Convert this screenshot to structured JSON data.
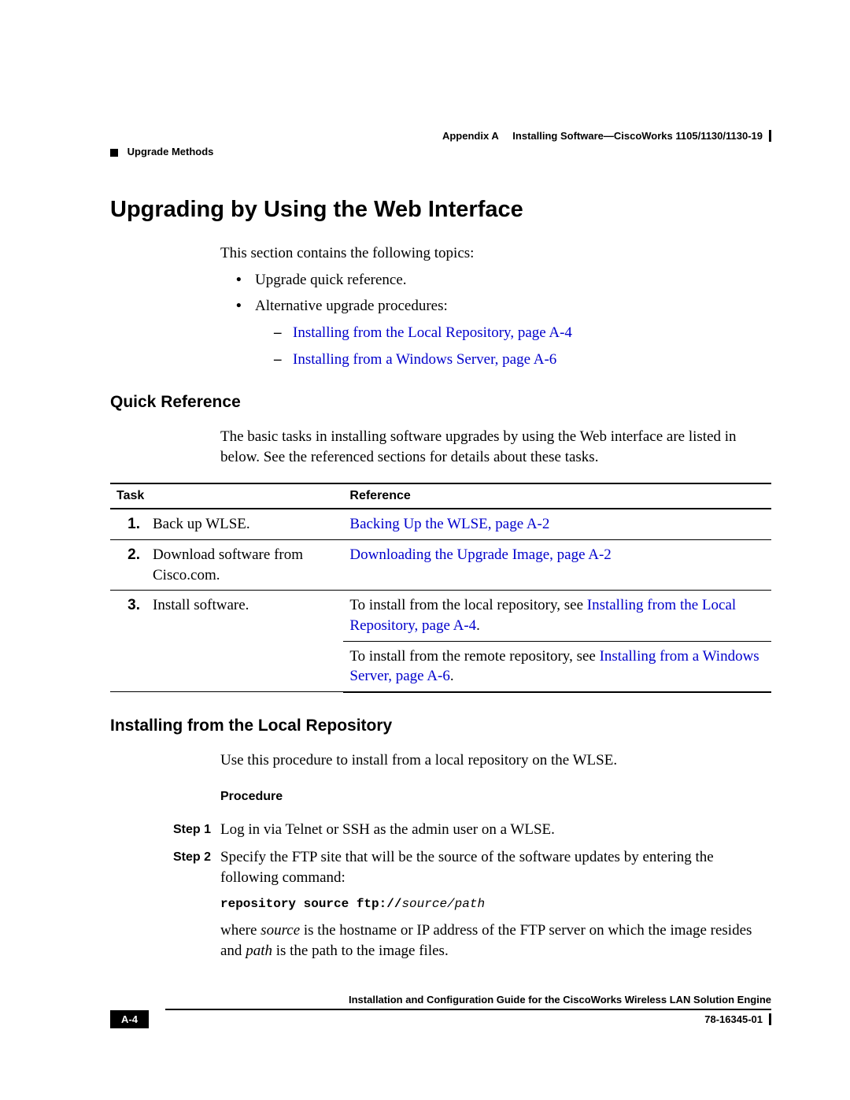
{
  "header": {
    "appendix": "Appendix A",
    "title": "Installing Software—CiscoWorks 1105/1130/1130-19",
    "section": "Upgrade Methods"
  },
  "h1": "Upgrading by Using the Web Interface",
  "intro": "This section contains the following topics:",
  "topics": {
    "item1": "Upgrade quick reference.",
    "item2": "Alternative upgrade procedures:",
    "sub1": "Installing from the Local Repository, page A-4",
    "sub2": "Installing from a Windows Server, page A-6"
  },
  "quickref": {
    "heading": "Quick Reference",
    "text": "The basic tasks in installing software upgrades by using the Web interface are listed in below. See the referenced sections for details about these tasks.",
    "th_task": "Task",
    "th_ref": "Reference",
    "rows": {
      "r1": {
        "n": "1.",
        "task": "Back up WLSE.",
        "ref": "Backing Up the WLSE, page A-2"
      },
      "r2": {
        "n": "2.",
        "task": "Download software from Cisco.com.",
        "ref": "Downloading the Upgrade Image, page A-2"
      },
      "r3": {
        "n": "3.",
        "task": "Install software.",
        "pre1": "To install from the local repository, see ",
        "link1": "Installing from the Local Repository, page A-4",
        "post1": ".",
        "pre2": "To install from the remote repository, see ",
        "link2": "Installing from a Windows Server, page A-6",
        "post2": "."
      }
    }
  },
  "localrepo": {
    "heading": "Installing from the Local Repository",
    "text": "Use this procedure to install from a local repository on the WLSE.",
    "proc": "Procedure",
    "step1_label": "Step 1",
    "step1": "Log in via Telnet or SSH as the admin user on a WLSE.",
    "step2_label": "Step 2",
    "step2": "Specify the FTP site that will be the source of the software updates by entering the following command:",
    "cmd_a": "repository source ftp://",
    "cmd_b": "source/path",
    "where_a": "where ",
    "where_src": "source",
    "where_b": " is the hostname or IP address of the FTP server on which the image resides and ",
    "where_path": "path",
    "where_c": " is the path to the image files."
  },
  "footer": {
    "guide": "Installation and Configuration Guide for the CiscoWorks Wireless LAN Solution Engine",
    "page": "A-4",
    "docnum": "78-16345-01"
  }
}
